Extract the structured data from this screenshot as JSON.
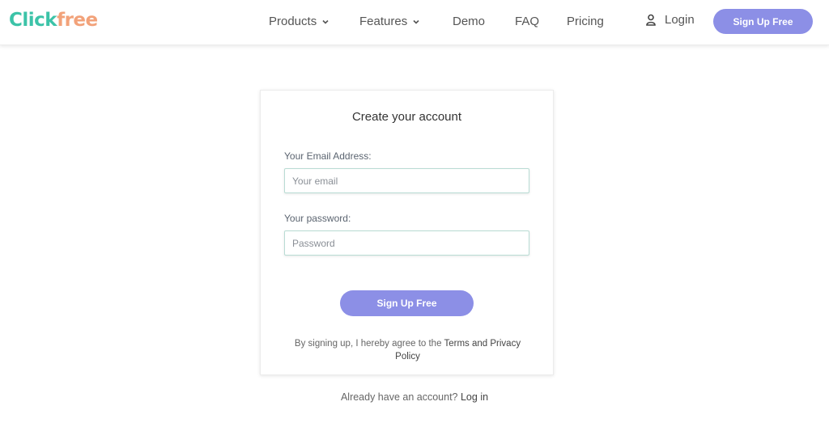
{
  "brand": {
    "part1": "Click",
    "part2": "free"
  },
  "nav": {
    "products": "Products",
    "features": "Features",
    "demo": "Demo",
    "faq": "FAQ",
    "pricing": "Pricing",
    "login": "Login",
    "signup": "Sign Up Free"
  },
  "form": {
    "title": "Create your account",
    "email_label": "Your Email Address:",
    "email_placeholder": "Your email",
    "email_value": "",
    "password_label": "Your password:",
    "password_placeholder": "Password",
    "password_value": "",
    "submit": "Sign Up Free",
    "terms_prefix": "By signing up, I hereby agree to the",
    "terms_link": "Terms and Privacy Policy"
  },
  "footer": {
    "prompt": "Already have an account?",
    "login_link": "Log in"
  },
  "colors": {
    "brand_teal": "#3cc3a8",
    "brand_orange": "#f2a27a",
    "accent": "#8c8fe6"
  },
  "icons": {
    "login": "user-icon",
    "dropdown": "chevron-down-icon"
  }
}
